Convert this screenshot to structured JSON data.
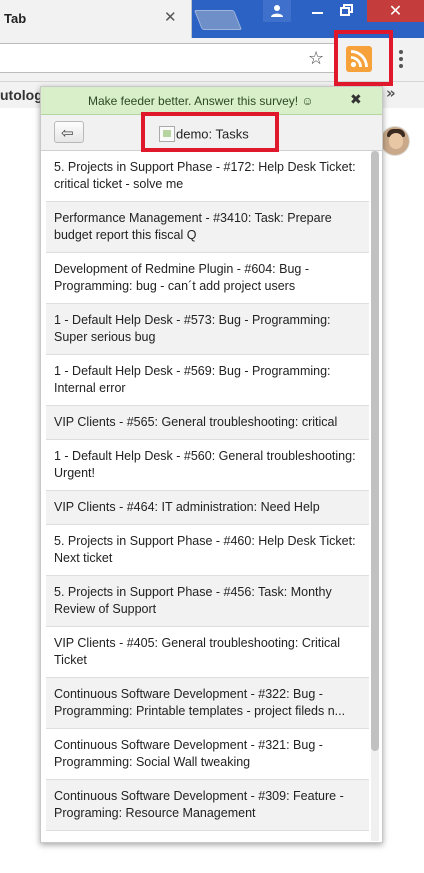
{
  "browser": {
    "tab_title": "Tab",
    "tab_close": "✕",
    "window_close": "✕",
    "star": "☆",
    "bookmark_text": "utolog",
    "bookmarks_overflow": "»"
  },
  "popup": {
    "survey_text": "Make feeder better. Answer this survey! ☺",
    "survey_close": "✖",
    "back_arrow": "⇦",
    "feed_title": "demo: Tasks",
    "tasks": [
      "5. Projects in Support Phase - #172: Help Desk Ticket: critical ticket - solve me",
      "Performance Management - #3410: Task: Prepare budget report this fiscal Q",
      "Development of Redmine Plugin - #604: Bug - Programming: bug - can´t add project users",
      "1 - Default Help Desk - #573: Bug - Programming: Super serious bug",
      "1 - Default Help Desk - #569: Bug - Programming: Internal error",
      "VIP Clients - #565: General troubleshooting: critical",
      "1 - Default Help Desk - #560: General troubleshooting: Urgent!",
      "VIP Clients - #464: IT administration: Need Help",
      "5. Projects in Support Phase - #460: Help Desk Ticket: Next ticket",
      "5. Projects in Support Phase - #456: Task: Monthy Review of Support",
      "VIP Clients - #405: General troubleshooting: Critical Ticket",
      "Continuous Software Development - #322: Bug - Programming: Printable templates - project fileds n...",
      "Continuous Software Development - #321: Bug - Programming: Social Wall tweaking",
      "Continuous Software Development - #309: Feature - Programing: Resource Management"
    ]
  },
  "colors": {
    "highlight": "#e0182b",
    "rss": "#f6a13a",
    "survey_bg": "#d9efc9",
    "titlebar": "#2b62c4"
  },
  "icons": [
    "star-icon",
    "rss-icon",
    "menu-icon",
    "back-arrow-icon",
    "close-icon",
    "user-icon",
    "broken-image-icon"
  ]
}
